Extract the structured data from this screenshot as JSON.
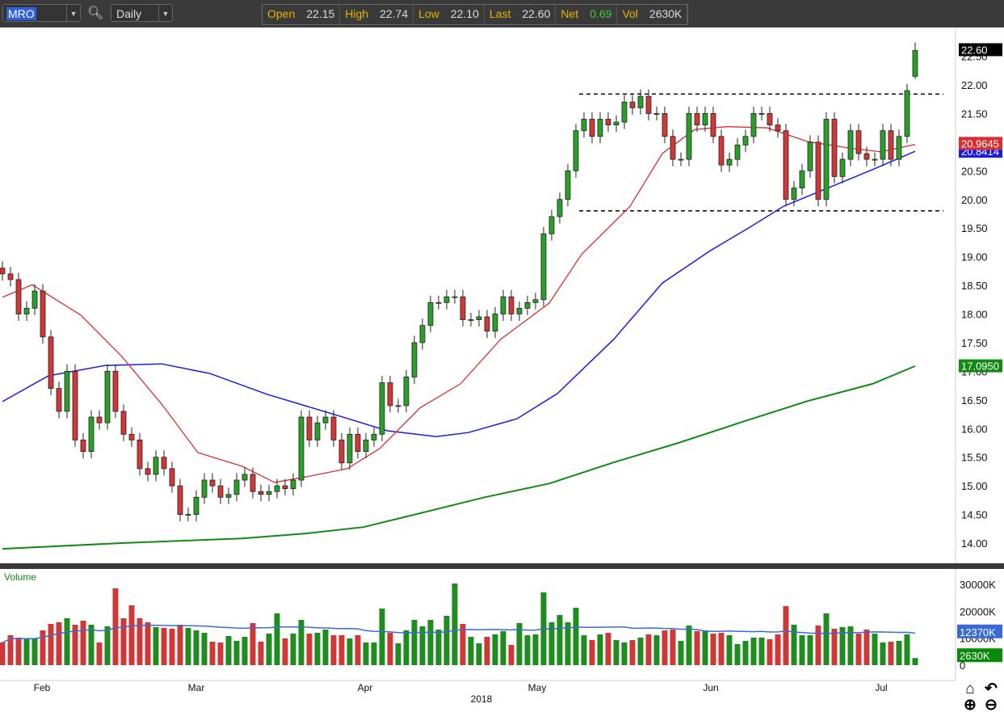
{
  "toolbar": {
    "symbol": "MRO",
    "period": "Daily",
    "search_icon": "search-icon",
    "quote": [
      {
        "k": "Open",
        "v": "22.15"
      },
      {
        "k": "High",
        "v": "22.74"
      },
      {
        "k": "Low",
        "v": "22.10"
      },
      {
        "k": "Last",
        "v": "22.60"
      },
      {
        "k": "Net",
        "v": "0.69"
      },
      {
        "k": "Vol",
        "v": "2630K"
      }
    ]
  },
  "colors": {
    "up": "#2aa02a",
    "down": "#d03838",
    "ma20": "#d83030",
    "ma50": "#1a1aee",
    "ma200": "#138a13",
    "net": "#3ecb3e"
  },
  "chart_data": {
    "type": "candlestick",
    "title": "MRO Daily",
    "price_axis": {
      "ticks": [
        "22.50",
        "22.00",
        "21.50",
        "21.00",
        "20.50",
        "20.00",
        "19.50",
        "19.00",
        "18.50",
        "18.00",
        "17.50",
        "17.00",
        "16.50",
        "16.00",
        "15.50",
        "15.00",
        "14.50",
        "14.00"
      ],
      "range": [
        13.6,
        22.9
      ]
    },
    "last_candle": {
      "open": 22.15,
      "high": 22.74,
      "low": 22.1,
      "close": 22.6
    },
    "close": [
      18.7,
      18.6,
      18.0,
      18.1,
      18.4,
      17.6,
      16.7,
      16.3,
      17.0,
      15.8,
      15.6,
      16.2,
      16.1,
      17.0,
      16.3,
      15.9,
      15.8,
      15.3,
      15.2,
      15.5,
      15.3,
      15.0,
      14.5,
      14.5,
      14.8,
      15.1,
      15.0,
      14.8,
      14.85,
      15.1,
      15.2,
      14.9,
      14.85,
      14.9,
      15.0,
      14.95,
      15.1,
      16.2,
      15.8,
      16.1,
      16.2,
      15.8,
      15.4,
      15.9,
      15.6,
      15.8,
      15.9,
      16.8,
      16.4,
      16.4,
      16.9,
      17.5,
      17.8,
      18.2,
      18.2,
      18.3,
      18.3,
      17.9,
      17.9,
      17.95,
      17.7,
      18.0,
      18.3,
      18.0,
      18.1,
      18.2,
      18.25,
      19.4,
      19.7,
      20.0,
      20.5,
      21.2,
      21.4,
      21.1,
      21.4,
      21.3,
      21.35,
      21.7,
      21.6,
      21.8,
      21.5,
      21.5,
      21.1,
      20.7,
      20.7,
      21.5,
      21.3,
      21.5,
      21.1,
      20.6,
      20.7,
      20.95,
      21.1,
      21.5,
      21.5,
      21.3,
      21.2,
      20.0,
      20.2,
      20.5,
      21.0,
      20.0,
      21.4,
      20.4,
      20.7,
      21.2,
      20.8,
      20.7,
      20.7,
      21.2,
      20.7,
      21.1,
      21.9,
      22.6
    ],
    "volume_k": [
      8400,
      11100,
      10200,
      9600,
      9900,
      12900,
      15300,
      15900,
      17400,
      15000,
      16500,
      15000,
      8400,
      14400,
      28500,
      17400,
      22200,
      17400,
      15900,
      14100,
      13800,
      13500,
      15000,
      13800,
      12900,
      12000,
      8700,
      8400,
      10800,
      9000,
      10500,
      15600,
      8700,
      11700,
      19200,
      9900,
      11700,
      16800,
      11700,
      12000,
      13200,
      11100,
      11100,
      9900,
      11100,
      8400,
      8400,
      21000,
      12000,
      8100,
      12900,
      16800,
      14400,
      16800,
      13200,
      18300,
      30300,
      15300,
      10500,
      8100,
      10500,
      11400,
      12600,
      7500,
      15600,
      11100,
      11400,
      27000,
      15900,
      18600,
      15900,
      21300,
      11100,
      9300,
      11400,
      12000,
      9300,
      8400,
      9300,
      10200,
      11400,
      11100,
      12900,
      13200,
      9000,
      14700,
      12600,
      12900,
      11700,
      12000,
      11100,
      7800,
      9000,
      10200,
      10200,
      9600,
      11400,
      21900,
      15000,
      11100,
      11100,
      14700,
      19200,
      13500,
      14100,
      14400,
      11700,
      13200,
      11700,
      8400,
      8700,
      9000,
      11400,
      2630
    ],
    "ma20": [
      [
        0,
        18.29
      ],
      [
        3.7,
        18.51
      ],
      [
        9.7,
        17.98
      ],
      [
        14.7,
        17.27
      ],
      [
        19.7,
        16.43
      ],
      [
        24.2,
        15.58
      ],
      [
        29.7,
        15.34
      ],
      [
        33.7,
        15.06
      ],
      [
        37.7,
        15.16
      ],
      [
        42.7,
        15.3
      ],
      [
        46.7,
        15.65
      ],
      [
        51.7,
        16.36
      ],
      [
        56.7,
        16.78
      ],
      [
        61.7,
        17.56
      ],
      [
        67.7,
        18.19
      ],
      [
        71.7,
        19.04
      ],
      [
        77.7,
        19.88
      ],
      [
        81.7,
        20.8
      ],
      [
        85.7,
        21.22
      ],
      [
        89.7,
        21.27
      ],
      [
        94.7,
        21.25
      ],
      [
        99.7,
        21.01
      ],
      [
        104.7,
        20.9
      ],
      [
        108.7,
        20.83
      ],
      [
        113,
        20.96
      ]
    ],
    "ma50": [
      [
        0,
        16.47
      ],
      [
        5.7,
        16.92
      ],
      [
        12.7,
        17.1
      ],
      [
        19.7,
        17.13
      ],
      [
        25.7,
        16.96
      ],
      [
        32.7,
        16.6
      ],
      [
        41.7,
        16.22
      ],
      [
        47.7,
        15.96
      ],
      [
        53.7,
        15.86
      ],
      [
        57.7,
        15.93
      ],
      [
        63.7,
        16.17
      ],
      [
        68.7,
        16.61
      ],
      [
        75.7,
        17.56
      ],
      [
        81.7,
        18.54
      ],
      [
        87.7,
        19.11
      ],
      [
        92.7,
        19.53
      ],
      [
        96.7,
        19.88
      ],
      [
        101.7,
        20.17
      ],
      [
        107.7,
        20.52
      ],
      [
        113,
        20.84
      ]
    ],
    "ma200": [
      [
        0,
        13.9
      ],
      [
        14.7,
        14.0
      ],
      [
        29.7,
        14.08
      ],
      [
        37.7,
        14.17
      ],
      [
        44.7,
        14.28
      ],
      [
        51.7,
        14.52
      ],
      [
        59.7,
        14.8
      ],
      [
        67.7,
        15.04
      ],
      [
        75.7,
        15.41
      ],
      [
        83.7,
        15.75
      ],
      [
        91.7,
        16.12
      ],
      [
        99.7,
        16.48
      ],
      [
        107.7,
        16.78
      ],
      [
        113,
        17.09
      ]
    ],
    "resistance": 21.84,
    "support": 19.8,
    "labels": {
      "last": "22.60",
      "ma20": "20.9645",
      "ma50": "20.8414",
      "ma200": "17.0950",
      "volume_title": "Volume",
      "vol_ma": "12370K",
      "vol_last": "2630K"
    },
    "volume_axis": {
      "ticks": [
        "30000K",
        "20000K",
        "10000K",
        "0"
      ]
    },
    "x_axis": {
      "months": [
        {
          "label": "Feb",
          "index": 4.9
        },
        {
          "label": "Mar",
          "index": 24
        },
        {
          "label": "Apr",
          "index": 44.9
        },
        {
          "label": "May",
          "index": 66.2
        },
        {
          "label": "Jun",
          "index": 87.7
        },
        {
          "label": "Jul",
          "index": 108.8
        }
      ],
      "year": {
        "label": "2018",
        "index": 59.3
      }
    }
  },
  "nav_icons": [
    "home-icon",
    "undo-icon",
    "zoom-in-icon",
    "zoom-out-icon"
  ]
}
